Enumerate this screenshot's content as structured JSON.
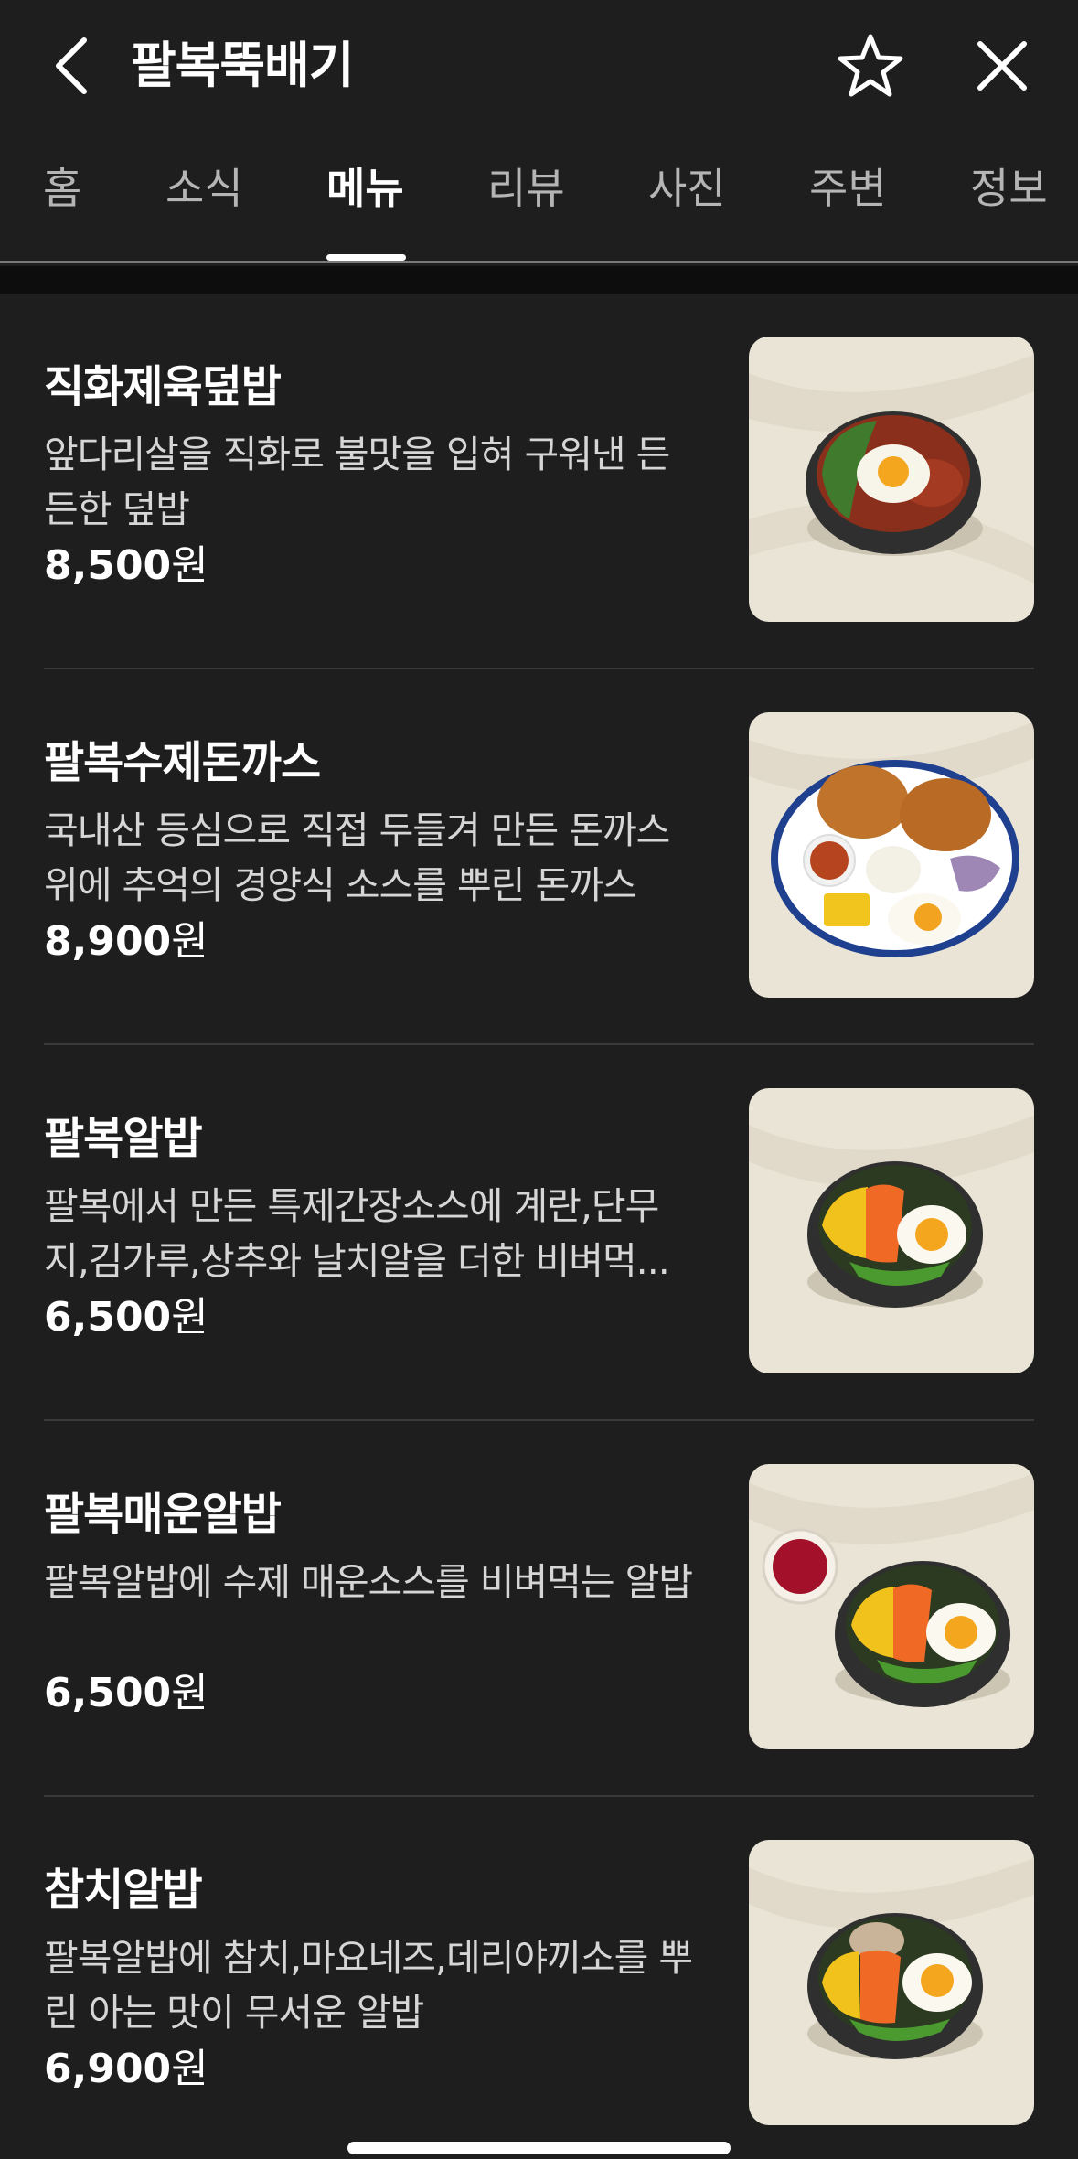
{
  "header": {
    "title": "팔복뚝배기"
  },
  "tabs": [
    {
      "label": "홈",
      "active": false
    },
    {
      "label": "소식",
      "active": false
    },
    {
      "label": "메뉴",
      "active": true
    },
    {
      "label": "리뷰",
      "active": false
    },
    {
      "label": "사진",
      "active": false
    },
    {
      "label": "주변",
      "active": false
    },
    {
      "label": "정보",
      "active": false
    }
  ],
  "menu": [
    {
      "name": "직화제육덮밥",
      "desc": "앞다리살을 직화로 불맛을 입혀 구워낸 든든한 덮밥",
      "price": "8,500",
      "unit": "원"
    },
    {
      "name": "팔복수제돈까스",
      "desc": "국내산 등심으로 직접 두들겨 만든 돈까스 위에 추억의 경양식 소스를 뿌린 돈까스",
      "price": "8,900",
      "unit": "원"
    },
    {
      "name": "팔복알밥",
      "desc": "팔복에서 만든 특제간장소스에 계란,단무지,김가루,상추와 날치알을 더한 비벼먹...",
      "price": "6,500",
      "unit": "원"
    },
    {
      "name": "팔복매운알밥",
      "desc": "팔복알밥에 수제 매운소스를 비벼먹는 알밥",
      "price": "6,500",
      "unit": "원"
    },
    {
      "name": "참치알밥",
      "desc": "팔복알밥에 참치,마요네즈,데리야끼소를 뿌린 아는 맛이 무서운 알밥",
      "price": "6,900",
      "unit": "원"
    }
  ],
  "colors": {
    "background": "#1e1e1e",
    "text_primary": "#ffffff",
    "text_secondary": "#d6d6d6",
    "tab_inactive": "#b5b5b5",
    "divider": "#3a3a3a"
  }
}
